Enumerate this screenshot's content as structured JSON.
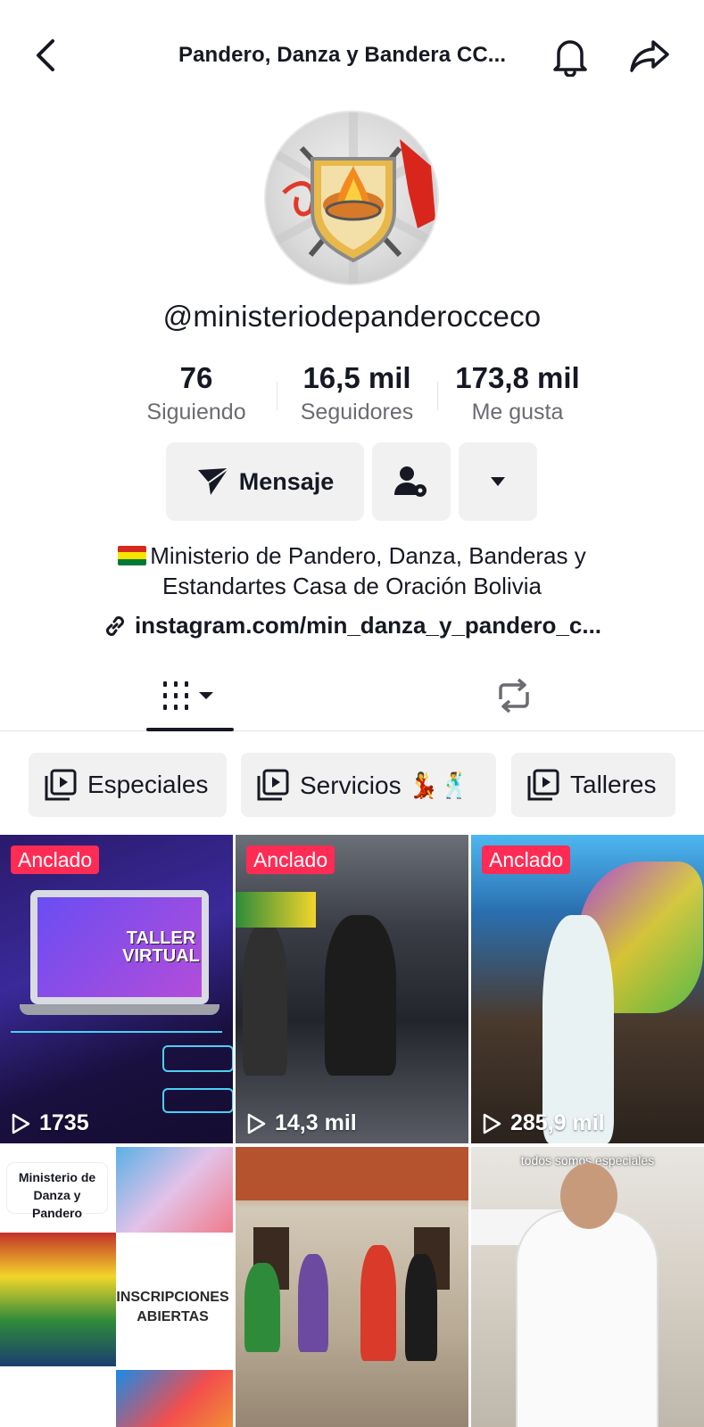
{
  "header": {
    "title": "Pandero, Danza y Bandera CC..."
  },
  "profile": {
    "username": "@ministeriodepanderocceco",
    "stats": [
      {
        "value": "76",
        "label": "Siguiendo"
      },
      {
        "value": "16,5 mil",
        "label": "Seguidores"
      },
      {
        "value": "173,8 mil",
        "label": "Me gusta"
      }
    ],
    "message_label": "Mensaje",
    "bio_line1": "Ministerio de Pandero, Danza, Banderas y",
    "bio_line2": "Estandartes Casa de Oración Bolivia",
    "link": "instagram.com/min_danza_y_pandero_c..."
  },
  "playlists": [
    {
      "label": "Especiales"
    },
    {
      "label": "Servicios 💃🕺"
    },
    {
      "label": "Talleres"
    }
  ],
  "videos": [
    {
      "pinned": "Anclado",
      "views": "1735",
      "title": "TALLER VIRTUAL"
    },
    {
      "pinned": "Anclado",
      "views": "14,3 mil"
    },
    {
      "pinned": "Anclado",
      "views": "285,9 mil"
    },
    {
      "tile_text": "Ministerio de Danza y Pandero",
      "tile_text2": "INSCRIPCIONES ABIERTAS"
    },
    {},
    {
      "caption": "todos somos especiales"
    }
  ],
  "colors": {
    "accent": "#fe2c55",
    "text": "#161823",
    "muted": "#6b6c72",
    "button_bg": "#f1f1f2"
  }
}
